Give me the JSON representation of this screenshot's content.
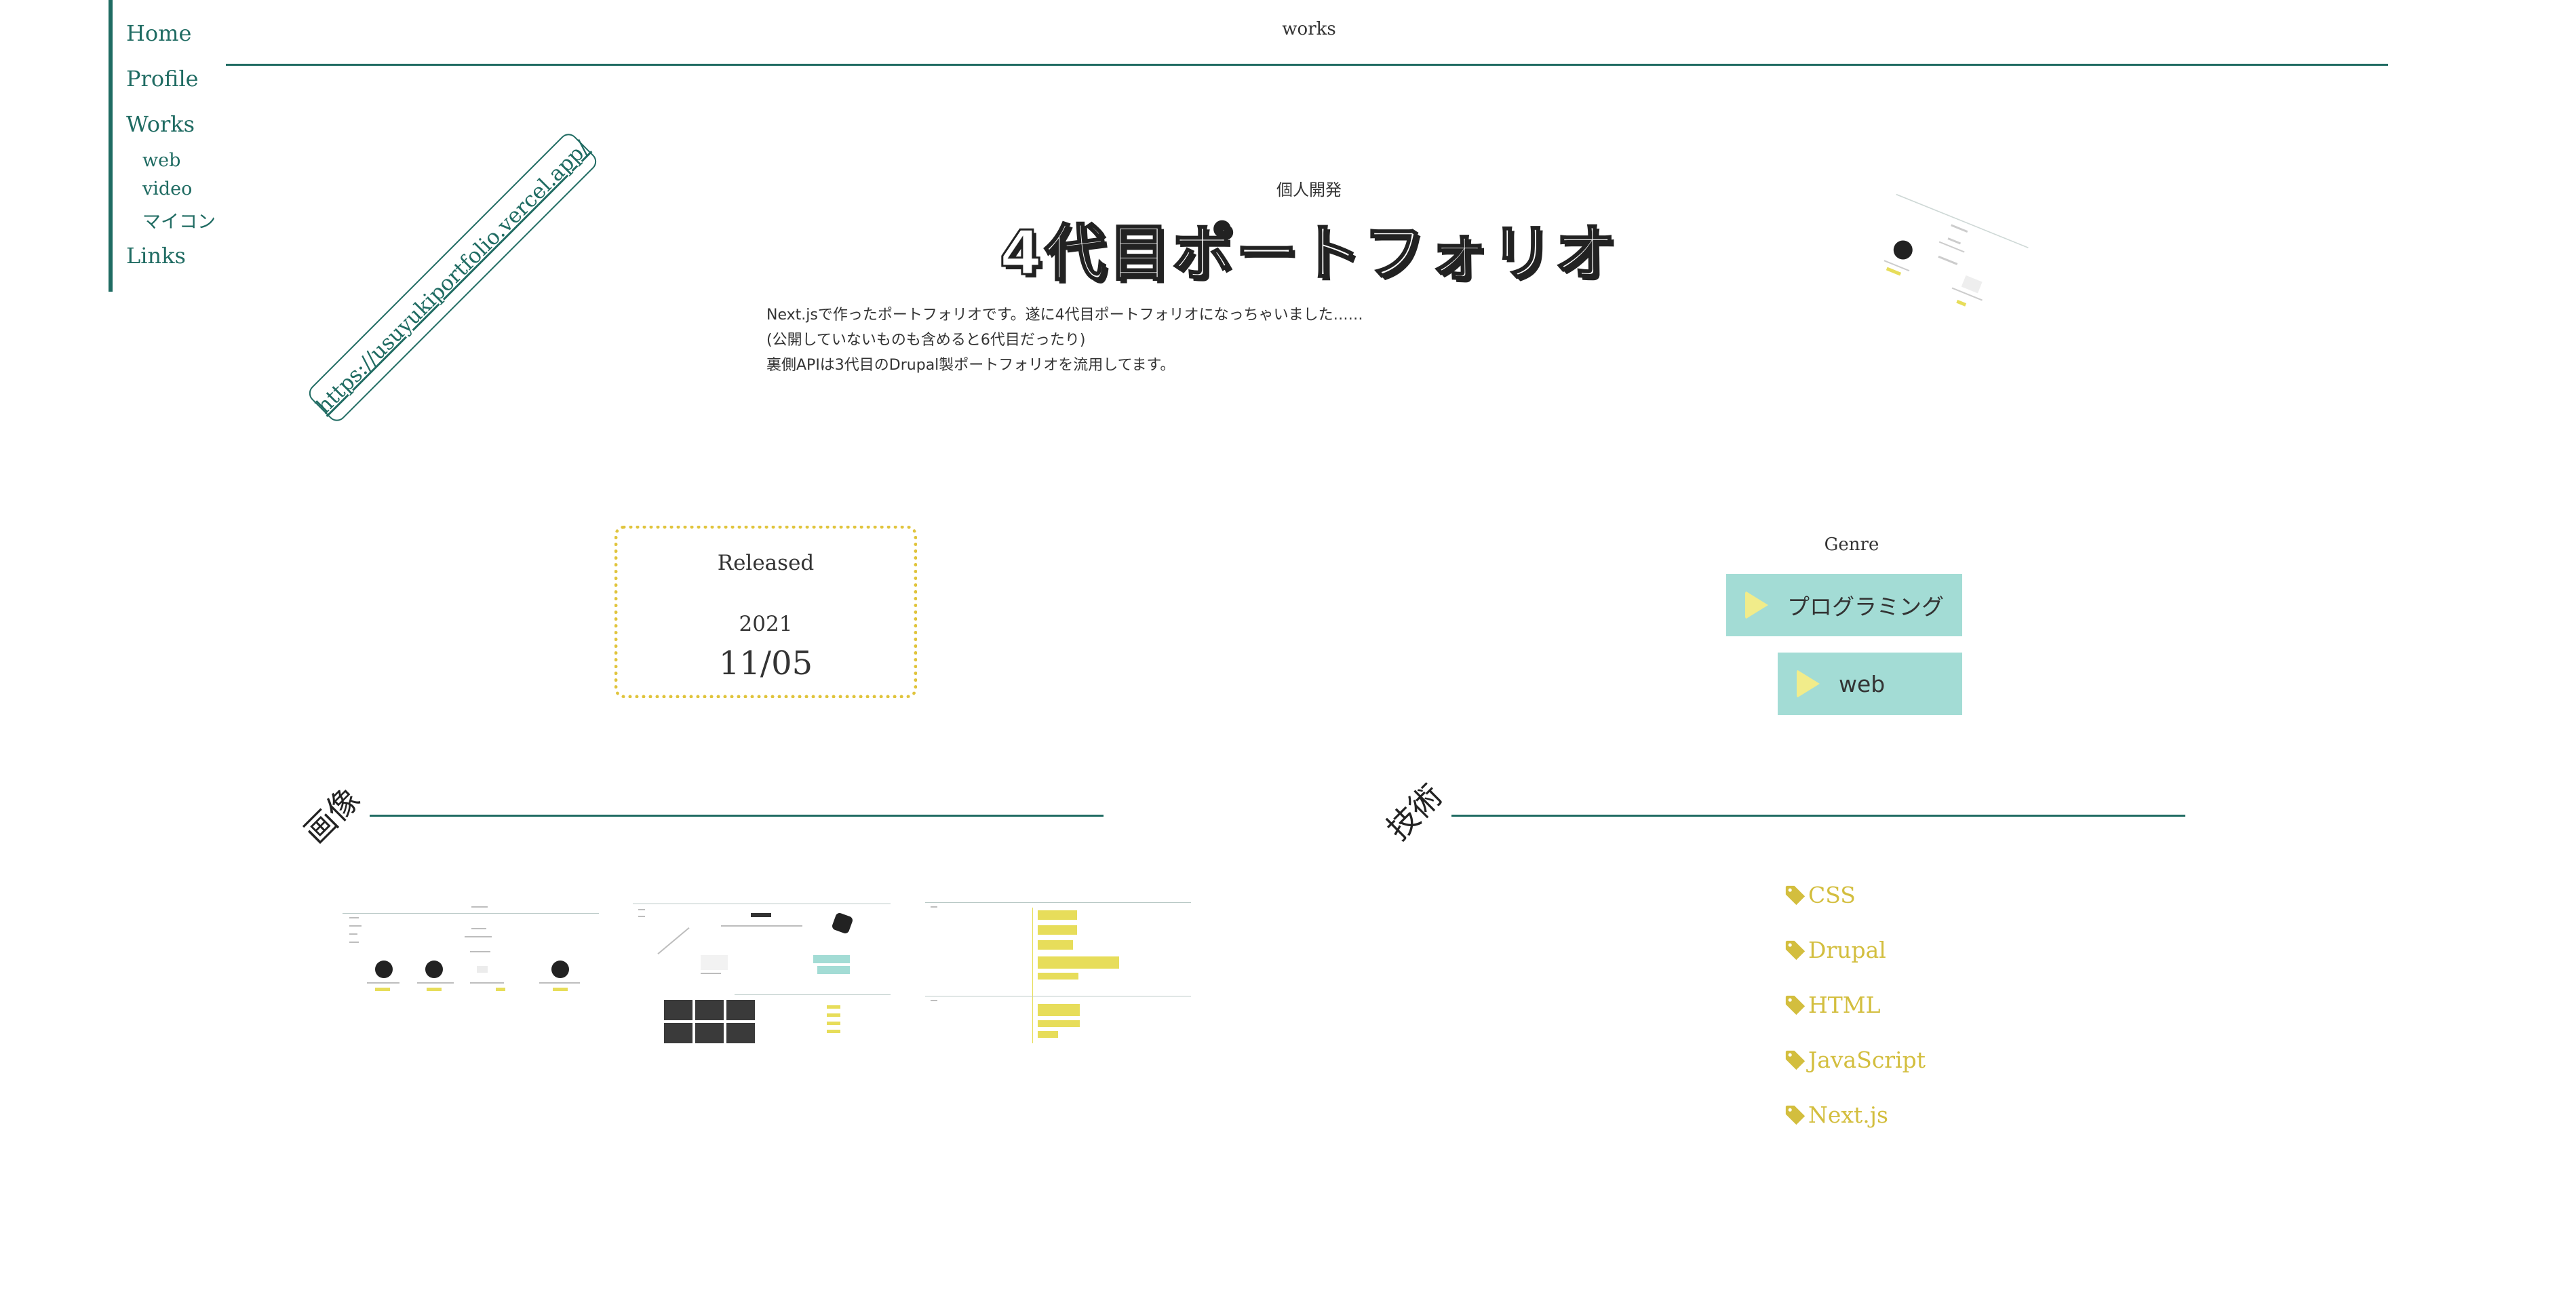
{
  "nav": {
    "home": "Home",
    "profile": "Profile",
    "works": "Works",
    "web": "web",
    "video": "video",
    "maikon": "マイコン",
    "links": "Links"
  },
  "header": {
    "page_label": "works"
  },
  "work": {
    "url": "https://usuyukiportfolio.vercel.app/",
    "category": "個人開発",
    "title": "4代目ポートフォリオ",
    "description": [
      "Next.jsで作ったポートフォリオです。遂に4代目ポートフォリオになっちゃいました……",
      "(公開していないものも含めると6代目だったり)",
      "裏側APIは3代目のDrupal製ポートフォリオを流用してます。"
    ]
  },
  "released": {
    "label": "Released",
    "year": "2021",
    "date": "11/05"
  },
  "genre": {
    "label": "Genre",
    "items": [
      "プログラミング",
      "web"
    ]
  },
  "sections": {
    "images": "画像",
    "tech": "技術"
  },
  "tech_tags": [
    "CSS",
    "Drupal",
    "HTML",
    "JavaScript",
    "Next.js"
  ],
  "colors": {
    "accent": "#1f6b62",
    "tag": "#d3be3e",
    "genre_bg": "#a3dcd5",
    "play": "#f1ec8a",
    "released_border": "#e0c43c"
  }
}
